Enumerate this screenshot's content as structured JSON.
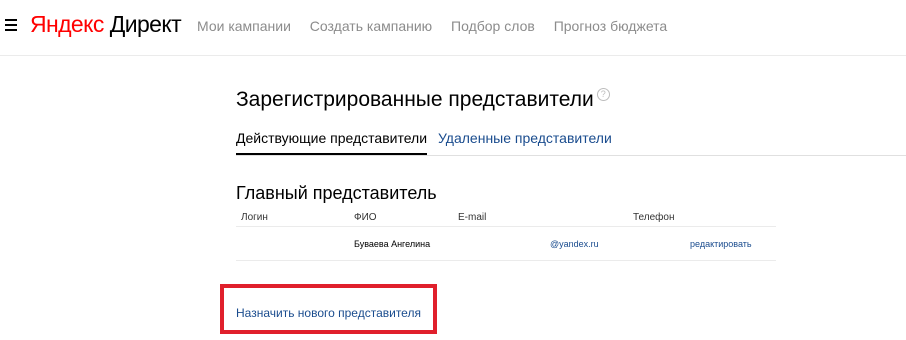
{
  "header": {
    "logo": {
      "yandex": "Яндекс",
      "direct": "Директ"
    },
    "nav": [
      {
        "label": "Мои кампании"
      },
      {
        "label": "Создать кампанию"
      },
      {
        "label": "Подбор слов"
      },
      {
        "label": "Прогноз бюджета"
      }
    ]
  },
  "page": {
    "title": "Зарегистрированные представители",
    "help_glyph": "?"
  },
  "tabs": [
    {
      "label": "Действующие представители",
      "active": true
    },
    {
      "label": "Удаленные представители",
      "active": false
    }
  ],
  "main_rep": {
    "title": "Главный представитель",
    "columns": {
      "login": "Логин",
      "name": "ФИО",
      "email": "E-mail",
      "phone": "Телефон"
    },
    "row": {
      "login": "",
      "name": "Буваева Ангелина",
      "email": "@yandex.ru",
      "phone": "",
      "action": "редактировать"
    }
  },
  "assign_new": "Назначить нового представителя",
  "colors": {
    "brand_red": "#ff0000",
    "link_blue": "#1a4c8e",
    "nav_gray": "#8c8c8c",
    "highlight": "#e0202c"
  }
}
